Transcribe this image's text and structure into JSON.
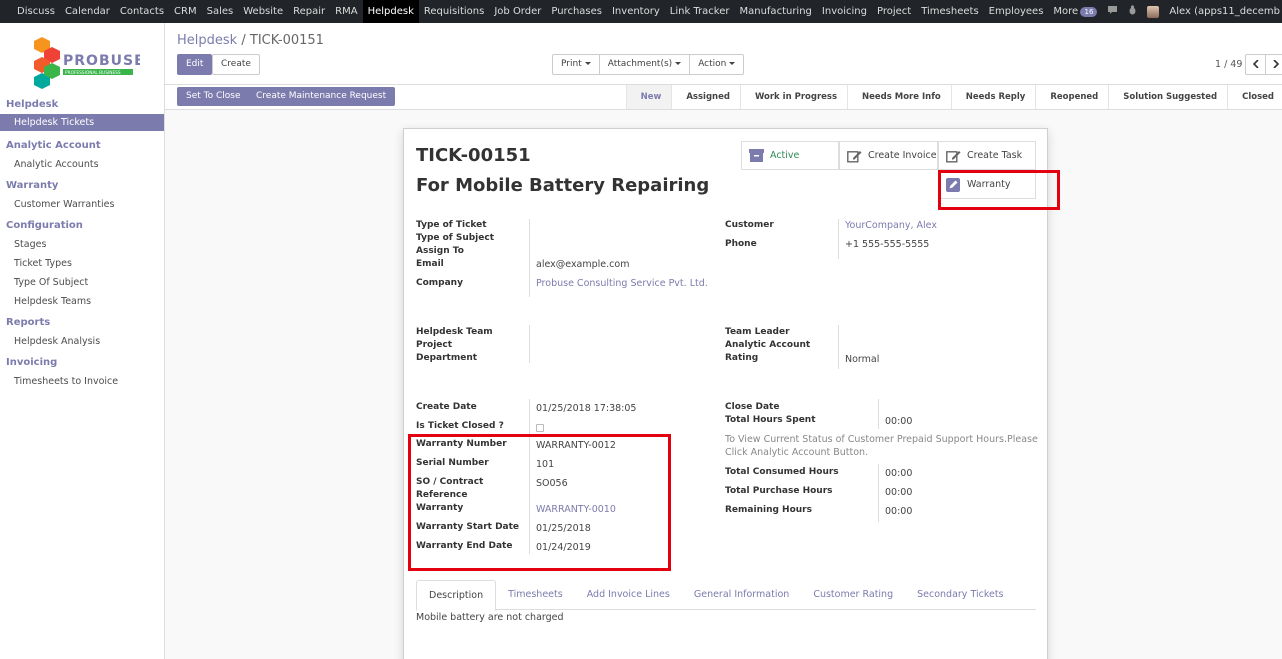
{
  "topnav": {
    "items": [
      "Discuss",
      "Calendar",
      "Contacts",
      "CRM",
      "Sales",
      "Website",
      "Repair",
      "RMA",
      "Helpdesk",
      "Requisitions",
      "Job Order",
      "Purchases",
      "Inventory",
      "Link Tracker",
      "Manufacturing",
      "Invoicing",
      "Project",
      "Timesheets",
      "Employees",
      "More"
    ],
    "active": "Helpdesk",
    "badge": "16",
    "user": "Alex (apps11_decemb"
  },
  "logo": {
    "brand": "PROBUSE",
    "tagline": "PROFESSIONAL BUSINESS"
  },
  "sidebar": {
    "sections": [
      {
        "title": "Helpdesk",
        "items": [
          "Helpdesk Tickets"
        ]
      },
      {
        "title": "Analytic Account",
        "items": [
          "Analytic Accounts"
        ]
      },
      {
        "title": "Warranty",
        "items": [
          "Customer Warranties"
        ]
      },
      {
        "title": "Configuration",
        "items": [
          "Stages",
          "Ticket Types",
          "Type Of Subject",
          "Helpdesk Teams"
        ]
      },
      {
        "title": "Reports",
        "items": [
          "Helpdesk Analysis"
        ]
      },
      {
        "title": "Invoicing",
        "items": [
          "Timesheets to Invoice"
        ]
      }
    ]
  },
  "breadcrumb": {
    "parent": "Helpdesk",
    "sep": "/",
    "current": "TICK-00151"
  },
  "buttons": {
    "edit": "Edit",
    "create": "Create",
    "print": "Print",
    "attachments": "Attachment(s)",
    "action": "Action",
    "pager": "1 / 49",
    "set_to_close": "Set To Close",
    "create_maintenance": "Create Maintenance Request"
  },
  "stages": [
    "New",
    "Assigned",
    "Work in Progress",
    "Needs More Info",
    "Needs Reply",
    "Reopened",
    "Solution Suggested",
    "Closed"
  ],
  "current_stage": "New",
  "smart_buttons": {
    "active": "Active",
    "create_invoice": "Create Invoice",
    "create_task": "Create Task",
    "warranty": "Warranty"
  },
  "ticket": {
    "number": "TICK-00151",
    "subject": "For Mobile Battery Repairing",
    "labels": {
      "type_of_ticket": "Type of Ticket",
      "type_of_subject": "Type of Subject",
      "assign_to": "Assign To",
      "email": "Email",
      "company": "Company",
      "customer": "Customer",
      "phone": "Phone",
      "helpdesk_team": "Helpdesk Team",
      "project": "Project",
      "department": "Department",
      "team_leader": "Team Leader",
      "analytic_account": "Analytic Account",
      "rating": "Rating",
      "create_date": "Create Date",
      "is_ticket_closed": "Is Ticket Closed ?",
      "warranty_number": "Warranty Number",
      "serial_number": "Serial Number",
      "so_contract": "SO / Contract",
      "reference": "Reference",
      "warranty": "Warranty",
      "warranty_start": "Warranty Start Date",
      "warranty_end": "Warranty End Date",
      "close_date": "Close Date",
      "total_hours_spent": "Total Hours Spent",
      "total_consumed": "Total Consumed Hours",
      "total_purchase": "Total Purchase Hours",
      "remaining": "Remaining Hours"
    },
    "email": "alex@example.com",
    "company": "Probuse Consulting Service Pvt. Ltd.",
    "customer": "YourCompany, Alex",
    "phone": "+1 555-555-5555",
    "rating": "Normal",
    "create_date": "01/25/2018 17:38:05",
    "warranty_number": "WARRANTY-0012",
    "serial_number": "101",
    "so_contract": "SO056",
    "warranty": "WARRANTY-0010",
    "warranty_start": "01/25/2018",
    "warranty_end": "01/24/2019",
    "total_hours_spent": "00:00",
    "note_line1": "To View Current Status of Customer Prepaid Support Hours.Please",
    "note_line2": "Click Analytic Account Button.",
    "total_consumed": "00:00",
    "total_purchase": "00:00",
    "remaining": "00:00"
  },
  "tabs": [
    "Description",
    "Timesheets",
    "Add Invoice Lines",
    "General Information",
    "Customer Rating",
    "Secondary Tickets"
  ],
  "description": "Mobile battery are not charged",
  "colors": {
    "accent": "#7c7bad",
    "highlight": "#e3000f",
    "topbar": "#212529"
  }
}
